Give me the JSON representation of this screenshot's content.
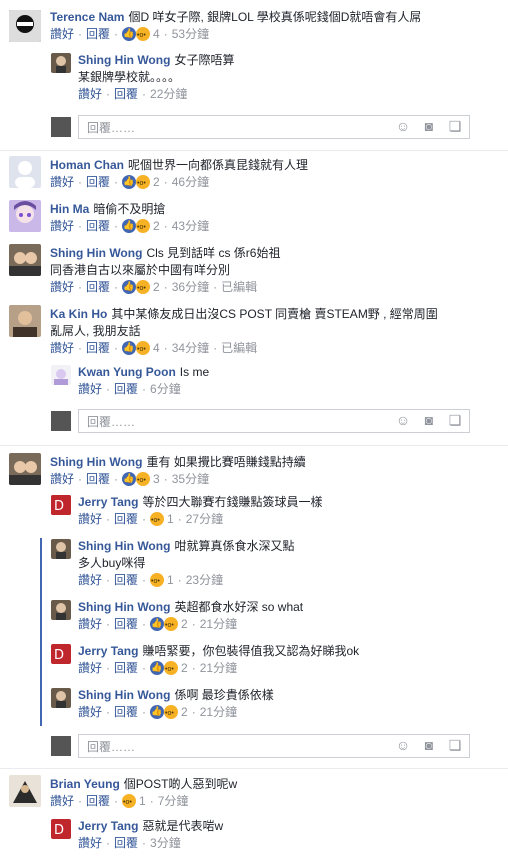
{
  "actions": {
    "like": "讚好",
    "reply": "回覆",
    "sep": "·",
    "edited": "已編輯"
  },
  "reply_placeholder": "回覆……",
  "comments": [
    {
      "name": "Terence Nam",
      "text": "個D 咩女子際, 銀牌LOL 學校真係呢錢個D就唔會有人屌",
      "count": "4",
      "time": "53分鐘",
      "reacts": [
        "like",
        "wow"
      ]
    },
    {
      "name": "Shing Hin Wong",
      "text1": "女子際唔算",
      "text2": "某銀牌學校就。。。。",
      "time": "22分鐘"
    },
    {
      "name": "Homan Chan",
      "text": "呢個世界一向都係真昆錢就有人理",
      "count": "2",
      "time": "46分鐘",
      "reacts": [
        "like",
        "wow"
      ]
    },
    {
      "name": "Hin Ma",
      "text": "暗偷不及明搶",
      "count": "2",
      "time": "43分鐘",
      "reacts": [
        "like",
        "wow"
      ]
    },
    {
      "name": "Shing Hin Wong",
      "text1": "Cls 見到話咩 cs 係r6始祖",
      "text2": "同香港自古以來屬於中國有咩分別",
      "count": "2",
      "time": "36分鐘",
      "reacts": [
        "like",
        "wow"
      ]
    },
    {
      "name": "Ka Kin Ho",
      "text1": "其中某條友成日出沒CS POST 同賣槍 賣STEAM野 , 經常周圍",
      "text2": "亂屌人, 我朋友話",
      "count": "4",
      "time": "34分鐘",
      "reacts": [
        "like",
        "wow"
      ]
    },
    {
      "name": "Kwan Yung Poon",
      "text": "Is me",
      "time": "6分鐘"
    },
    {
      "name": "Shing Hin Wong",
      "text": "重有 如果攪比賽唔賺錢點持續",
      "count": "3",
      "time": "35分鐘",
      "reacts": [
        "like",
        "wow"
      ]
    },
    {
      "name": "Jerry Tang",
      "text": "等於四大聯賽冇錢賺點簽球員一樣",
      "count": "1",
      "time": "27分鐘",
      "reacts": [
        "wow"
      ]
    },
    {
      "name": "Shing Hin Wong",
      "text1": "咁就算真係食水深又點",
      "text2": "多人buy咪得",
      "count": "1",
      "time": "23分鐘",
      "reacts": [
        "wow"
      ]
    },
    {
      "name": "Shing Hin Wong",
      "text": "英超都食水好深 so what",
      "count": "2",
      "time": "21分鐘",
      "reacts": [
        "like",
        "wow"
      ]
    },
    {
      "name": "Jerry Tang",
      "text": "賺唔緊要，你包裝得值我又認為好睇我ok",
      "count": "2",
      "time": "21分鐘",
      "reacts": [
        "like",
        "wow"
      ]
    },
    {
      "name": "Shing Hin Wong",
      "text": "係啊 最珍貴係依樣",
      "count": "2",
      "time": "21分鐘",
      "reacts": [
        "like",
        "wow"
      ]
    },
    {
      "name": "Brian Yeung",
      "text": "個POST啲人惡到呢w",
      "count": "1",
      "time": "7分鐘",
      "reacts": [
        "wow"
      ]
    },
    {
      "name": "Jerry Tang",
      "text": "惡就是代表啱w",
      "time": "3分鐘"
    }
  ],
  "colors": {
    "link": "#365899",
    "like": "#4267b2",
    "wow": "#f7b125",
    "thread": "#4267b2"
  }
}
